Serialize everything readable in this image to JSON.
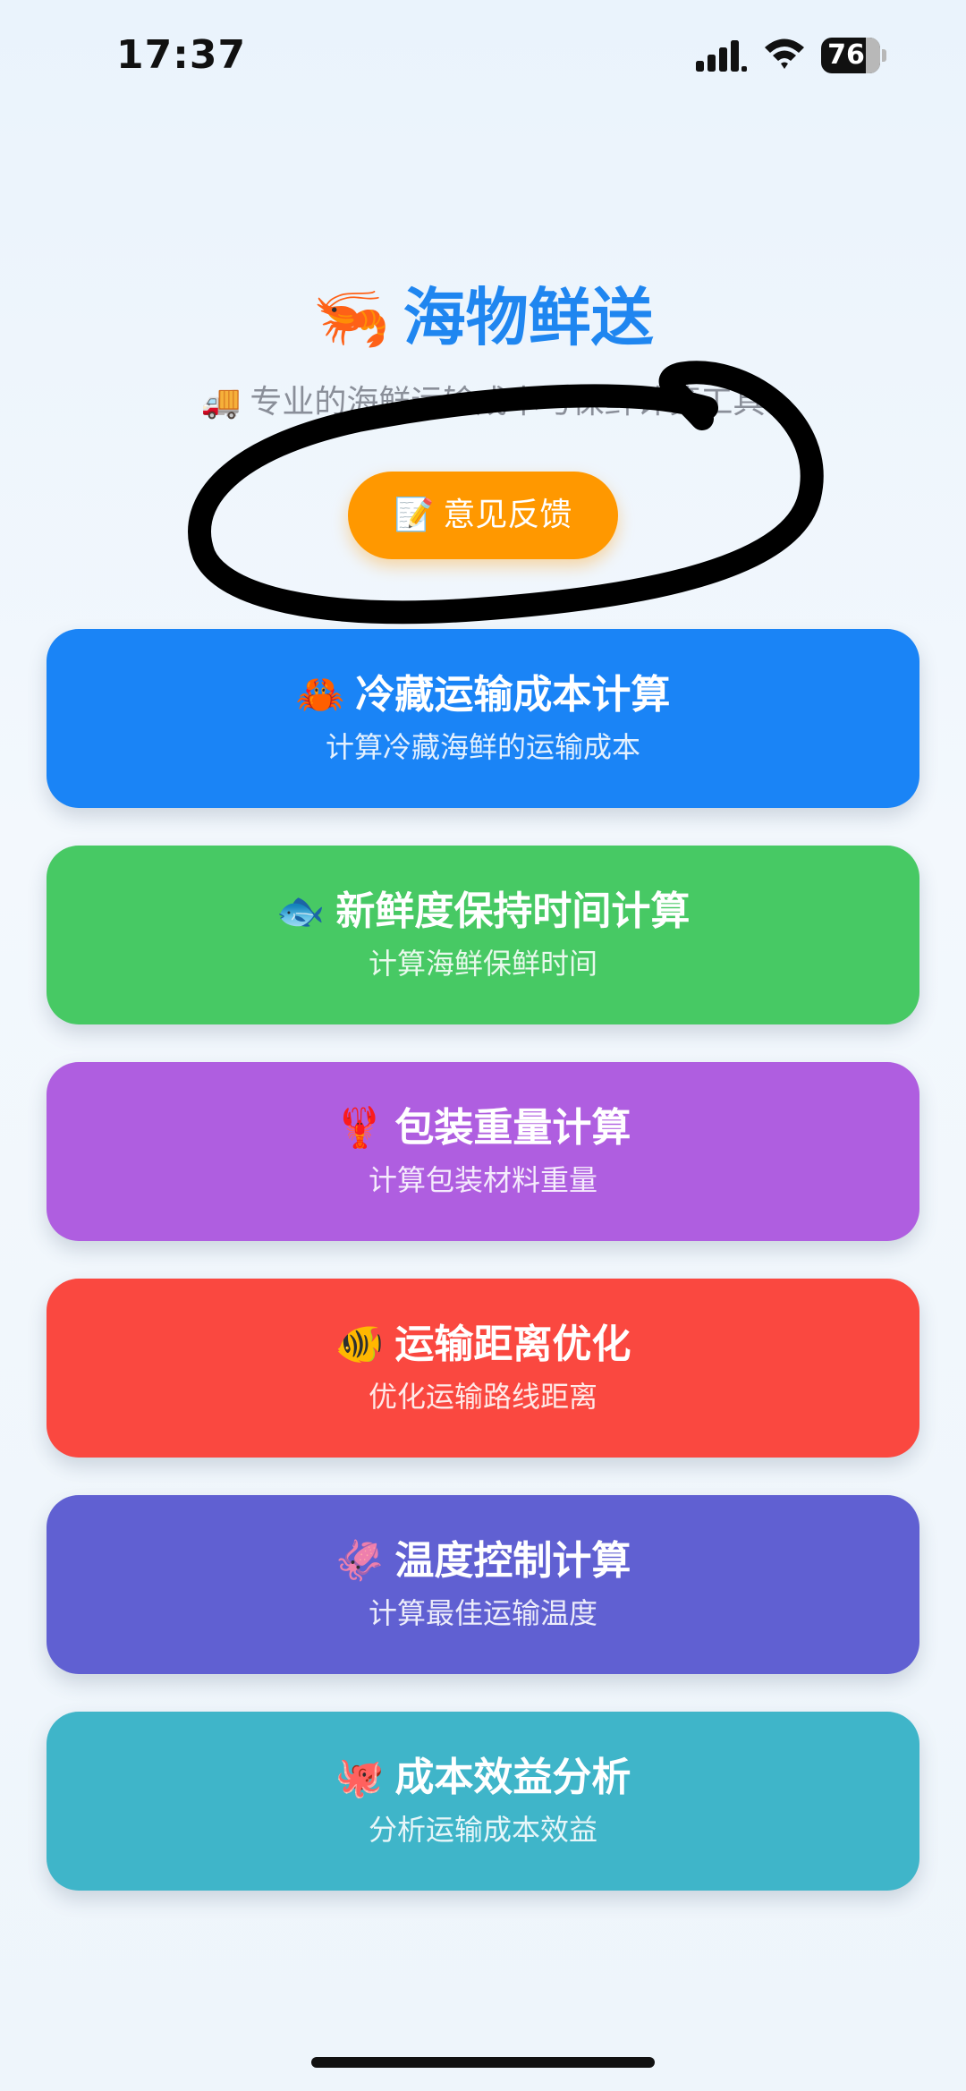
{
  "status_bar": {
    "time": "17:37",
    "battery_level": "76",
    "battery_fraction": 0.76,
    "icons": [
      "signal-icon",
      "wifi-icon",
      "battery-icon"
    ]
  },
  "header": {
    "title_icon": "🦐",
    "title": "海物鲜送",
    "subtitle_icon": "🚚",
    "subtitle": "专业的海鲜运输成本与保鲜计算工具"
  },
  "feedback_button": {
    "icon": "📝",
    "label": "意见反馈",
    "color": "#ff9800"
  },
  "cards": [
    {
      "icon": "🦀",
      "title": "冷藏运输成本计算",
      "subtitle": "计算冷藏海鲜的运输成本",
      "color": "#1a84f6"
    },
    {
      "icon": "🐟",
      "title": "新鲜度保持时间计算",
      "subtitle": "计算海鲜保鲜时间",
      "color": "#47c964"
    },
    {
      "icon": "🦞",
      "title": "包装重量计算",
      "subtitle": "计算包装材料重量",
      "color": "#af5ee0"
    },
    {
      "icon": "🐠",
      "title": "运输距离优化",
      "subtitle": "优化运输路线距离",
      "color": "#fa4840"
    },
    {
      "icon": "🦑",
      "title": "温度控制计算",
      "subtitle": "计算最佳运输温度",
      "color": "#6060d2"
    },
    {
      "icon": "🐙",
      "title": "成本效益分析",
      "subtitle": "分析运输成本效益",
      "color": "#3fb5c9"
    }
  ]
}
